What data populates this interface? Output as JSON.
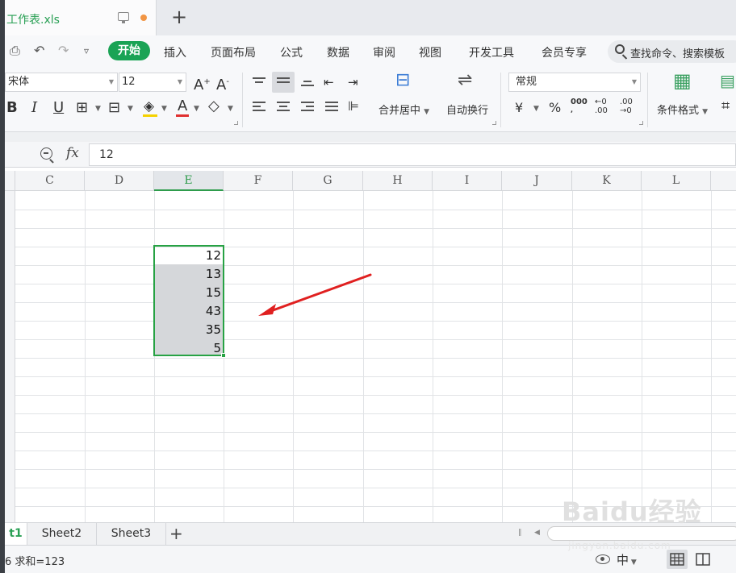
{
  "title_bar": {
    "file_tab": "工作表.xls",
    "add_tab": "+"
  },
  "menu": {
    "tabs": [
      "开始",
      "插入",
      "页面布局",
      "公式",
      "数据",
      "审阅",
      "视图",
      "开发工具",
      "会员专享"
    ],
    "search_placeholder": "查找命令、搜索模板"
  },
  "toolbar": {
    "font_name": "宋体",
    "font_size": "12",
    "grow_font": "A",
    "shrink_font": "A",
    "bold": "B",
    "italic": "I",
    "underline": "U",
    "font_color": "A",
    "merge_center": "合并居中",
    "wrap_text": "自动换行",
    "number_format": "常规",
    "currency": "¥",
    "percent": "%",
    "thousands": "000",
    "increase_decimal": "←0\n.00",
    "decrease_decimal": ".00\n→0",
    "conditional_format": "条件格式"
  },
  "formula_bar": {
    "fx": "fx",
    "value": "12"
  },
  "sheet": {
    "columns": [
      "C",
      "D",
      "E",
      "F",
      "G",
      "H",
      "I",
      "J",
      "K",
      "L"
    ],
    "active_column": "E",
    "selected_values": [
      "12",
      "13",
      "15",
      "43",
      "35",
      "5"
    ]
  },
  "sheet_tabs": {
    "tabs": [
      "t1",
      "Sheet2",
      "Sheet3"
    ],
    "add": "+"
  },
  "status_bar": {
    "text": "6  求和=123",
    "ime": "中"
  },
  "watermark": {
    "text": "Baidu经验",
    "sub": "jingyan.baidu.com"
  },
  "colors": {
    "accent_green": "#1aa355",
    "selection_border": "#27a244",
    "arrow_red": "#e02020"
  }
}
